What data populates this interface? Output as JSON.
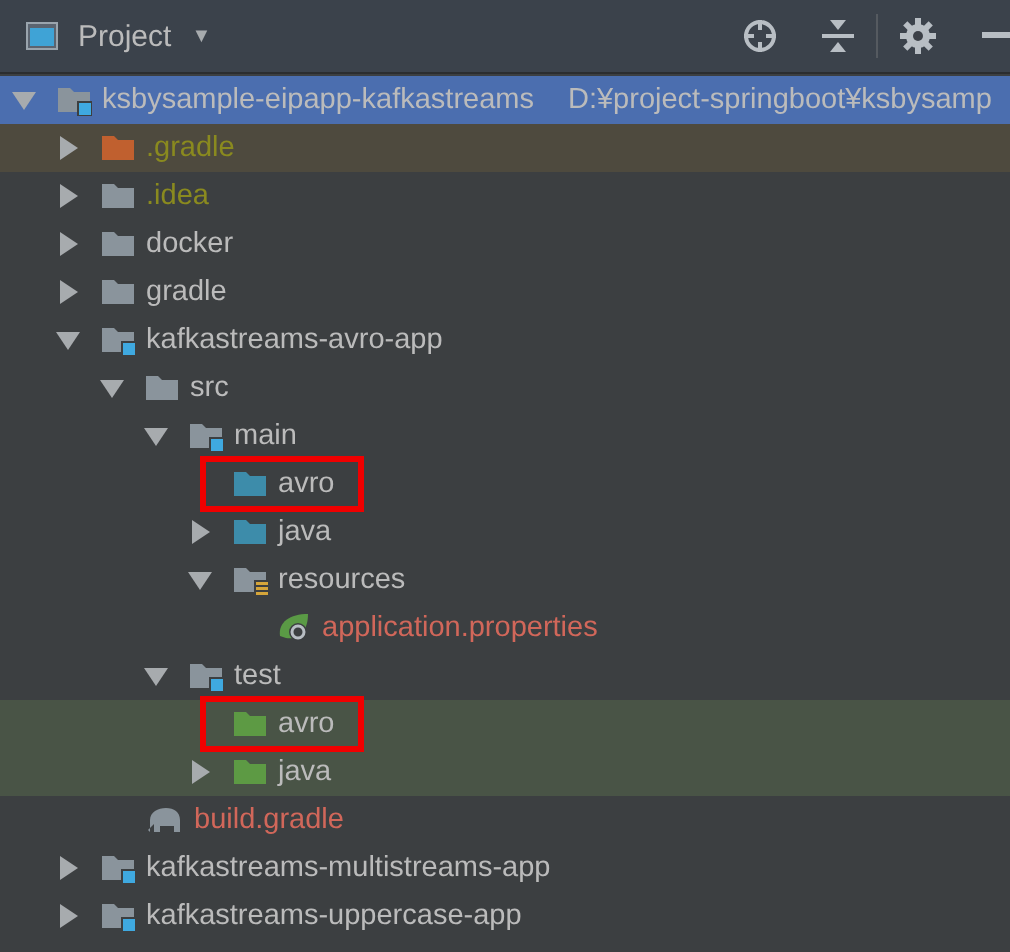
{
  "header": {
    "title": "Project",
    "caret": "▼"
  },
  "tree": [
    {
      "name": "ksbysample-eipapp-kafkastreams",
      "path": "D:¥project-springboot¥ksbysamp",
      "kind": "module",
      "expanded": true,
      "selected": true,
      "marked": false,
      "children": [
        {
          "name": ".gradle",
          "kind": "excluded",
          "color": "#8a8a1f",
          "expanded": false,
          "selected": false,
          "marked": false
        },
        {
          "name": ".idea",
          "kind": "folder",
          "color": "#8a8a1f",
          "expanded": false,
          "selected": false,
          "marked": false
        },
        {
          "name": "docker",
          "kind": "folder",
          "expanded": false,
          "selected": false,
          "marked": false
        },
        {
          "name": "gradle",
          "kind": "folder",
          "expanded": false,
          "selected": false,
          "marked": false
        },
        {
          "name": "kafkastreams-avro-app",
          "kind": "module",
          "expanded": true,
          "selected": false,
          "marked": false,
          "children": [
            {
              "name": "src",
              "kind": "folder",
              "expanded": true,
              "selected": false,
              "marked": false,
              "children": [
                {
                  "name": "main",
                  "kind": "module",
                  "expanded": true,
                  "selected": false,
                  "marked": false,
                  "children": [
                    {
                      "name": "avro",
                      "kind": "source",
                      "selected": false,
                      "marked": true
                    },
                    {
                      "name": "java",
                      "kind": "source",
                      "expanded": false,
                      "selected": false,
                      "marked": false
                    },
                    {
                      "name": "resources",
                      "kind": "resources",
                      "expanded": true,
                      "selected": false,
                      "marked": false,
                      "children": [
                        {
                          "name": "application.properties",
                          "kind": "properties",
                          "color": "#d1675a",
                          "selected": false,
                          "marked": false
                        }
                      ]
                    }
                  ]
                },
                {
                  "name": "test",
                  "kind": "module",
                  "expanded": true,
                  "selected": false,
                  "marked": false,
                  "children": [
                    {
                      "name": "avro",
                      "kind": "test-source",
                      "selected": false,
                      "marked": true
                    },
                    {
                      "name": "java",
                      "kind": "test-source",
                      "expanded": false,
                      "selected": false,
                      "marked": false
                    }
                  ]
                }
              ]
            },
            {
              "name": "build.gradle",
              "kind": "gradle",
              "color": "#d1675a",
              "selected": false,
              "marked": false
            }
          ]
        },
        {
          "name": "kafkastreams-multistreams-app",
          "kind": "module",
          "expanded": false,
          "selected": false,
          "marked": false
        },
        {
          "name": "kafkastreams-uppercase-app",
          "kind": "module",
          "expanded": false,
          "selected": false,
          "marked": false
        }
      ]
    }
  ]
}
